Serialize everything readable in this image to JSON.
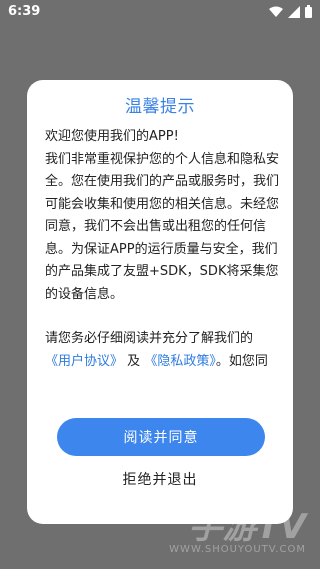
{
  "status_bar": {
    "time": "6:39",
    "icons": [
      "wifi-icon",
      "signal-icon",
      "battery-icon"
    ]
  },
  "dialog": {
    "title": "温馨提示",
    "paragraph_1": "欢迎您使用我们的APP!",
    "paragraph_2": "我们非常重视保护您的个人信息和隐私安全。您在使用我们的产品或服务时，我们可能会收集和使用您的相关信息。未经您同意，我们不会出售或出租您的任何信息。为保证APP的运行质量与安全，我们的产品集成了友盟+SDK，SDK将采集您的设备信息。",
    "agreement_intro": "请您务必仔细阅读并充分了解我们的",
    "user_agreement_link": "《用户协议》",
    "conjunction": "及",
    "privacy_policy_link": "《隐私政策》",
    "agreement_tail": "。如您同",
    "accept_label": "阅读并同意",
    "decline_label": "拒绝并退出"
  },
  "watermark": {
    "main": "手游TV",
    "sub": "WWW.SHOUYOUTV.COM"
  },
  "colors": {
    "accent": "#3c86ee",
    "link": "#2e7be0",
    "overlay": "#6f6f6f"
  }
}
